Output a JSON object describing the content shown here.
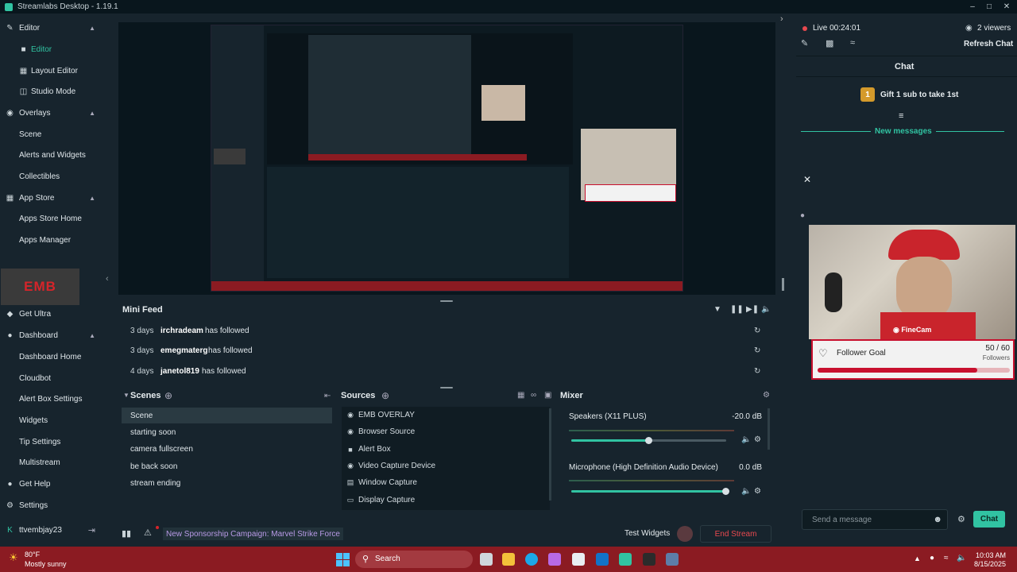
{
  "window": {
    "title": "Streamlabs Desktop - 1.19.1"
  },
  "sidebar": {
    "sections": [
      {
        "label": "Editor",
        "icon": "editor-icon"
      },
      {
        "label": "Overlays",
        "icon": "overlays-icon"
      },
      {
        "label": "App Store",
        "icon": "app-store-icon"
      },
      {
        "label": "Dashboard",
        "icon": "dashboard-icon"
      }
    ],
    "items": [
      {
        "label": "Editor",
        "active": true
      },
      {
        "label": "Layout Editor"
      },
      {
        "label": "Studio Mode"
      },
      {
        "label": "Scene"
      },
      {
        "label": "Alerts and Widgets"
      },
      {
        "label": "Collectibles"
      },
      {
        "label": "Apps Store Home"
      },
      {
        "label": "Apps Manager"
      },
      {
        "label": "Dashboard Home"
      },
      {
        "label": "Cloudbot"
      },
      {
        "label": "Alert Box Settings"
      },
      {
        "label": "Widgets"
      },
      {
        "label": "Tip Settings"
      },
      {
        "label": "Multistream"
      }
    ],
    "logo_text": "EMB",
    "get_ultra": "Get Ultra",
    "get_help": "Get Help",
    "settings": "Settings",
    "username": "ttvembjay23"
  },
  "mini_feed": {
    "title": "Mini Feed",
    "rows": [
      {
        "time": "3 days",
        "user": "irchradeam",
        "action": "has followed"
      },
      {
        "time": "3 days",
        "user": "emegmaterg",
        "action": "has followed"
      },
      {
        "time": "4 days",
        "user": "janetol819",
        "action": "has followed"
      }
    ]
  },
  "scenes": {
    "title": "Scenes",
    "items": [
      "Scene",
      "starting soon",
      "camera fullscreen",
      "be back soon",
      "stream ending"
    ]
  },
  "sources": {
    "title": "Sources",
    "items": [
      {
        "label": "EMB OVERLAY",
        "icon": "globe-icon"
      },
      {
        "label": "Browser Source",
        "icon": "globe-icon"
      },
      {
        "label": "Alert Box",
        "icon": "alert-box-icon"
      },
      {
        "label": "Video Capture Device",
        "icon": "camera-icon"
      },
      {
        "label": "Window Capture",
        "icon": "window-icon"
      },
      {
        "label": "Display Capture",
        "icon": "monitor-icon"
      }
    ]
  },
  "mixer": {
    "title": "Mixer",
    "channels": [
      {
        "name": "Speakers (X11 PLUS)",
        "level": "-20.0 dB",
        "volume": 0.5
      },
      {
        "name": "Microphone (High Definition Audio Device)",
        "level": "0.0 dB",
        "volume": 1.0
      }
    ]
  },
  "statusbar": {
    "campaign": "New Sponsorship Campaign: Marvel Strike Force",
    "test_widgets": "Test Widgets",
    "end_stream": "End Stream"
  },
  "chat_panel": {
    "live": "Live 00:24:01",
    "viewers": "2 viewers",
    "refresh": "Refresh Chat",
    "title": "Chat",
    "gift": "Gift 1 sub to take 1st",
    "gift_rank": "1",
    "new_messages": "New messages",
    "placeholder": "Send a message",
    "send": "Chat",
    "cam_label": "FineCam",
    "goal": {
      "title": "Follower Goal",
      "count": "50 / 60",
      "unit": "Followers",
      "progress": 0.83
    }
  },
  "taskbar": {
    "temp": "80°F",
    "weather": "Mostly sunny",
    "search": "Search",
    "time": "10:03 AM",
    "date": "8/15/2025"
  },
  "colors": {
    "accent": "#31c3a2",
    "danger": "#d6242a",
    "taskbar": "#8b1b22"
  }
}
